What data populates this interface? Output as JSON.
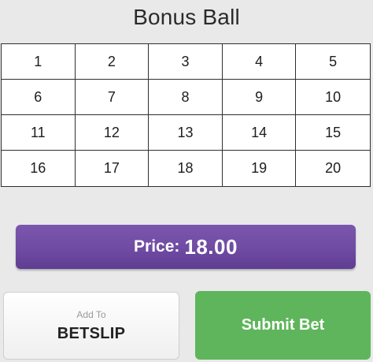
{
  "title": "Bonus Ball",
  "balls": [
    "1",
    "2",
    "3",
    "4",
    "5",
    "6",
    "7",
    "8",
    "9",
    "10",
    "11",
    "12",
    "13",
    "14",
    "15",
    "16",
    "17",
    "18",
    "19",
    "20"
  ],
  "price": {
    "label": "Price:",
    "value": "18.00"
  },
  "add_to_betslip": {
    "small_label": "Add To",
    "main_label": "BETSLIP"
  },
  "submit": {
    "label": "Submit Bet"
  },
  "colors": {
    "price_bar": "#6f4ba3",
    "submit_button": "#5fb55b",
    "background": "#e9e9e9"
  }
}
